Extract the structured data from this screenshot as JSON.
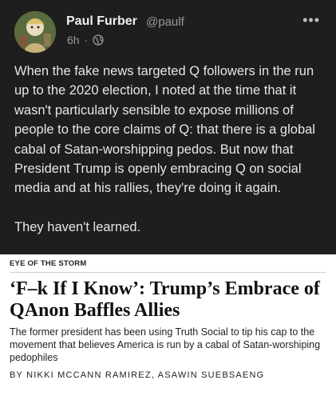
{
  "post": {
    "author_name": "Paul Furber",
    "author_handle": "@paulf",
    "age": "6h",
    "separator": "·",
    "more_label": "•••",
    "paragraphs": [
      "When the fake news targeted Q followers in the run up to the 2020 election, I noted at the time that it wasn't particularly sensible to expose millions of people to the core claims of Q: that there is a global cabal of Satan-worshipping pedos. But now that President Trump is openly embracing Q on social media and at his rallies, they're doing it again.",
      "They haven't learned."
    ]
  },
  "article": {
    "kicker": "EYE OF THE STORM",
    "headline": "‘F–k If I Know’: Trump’s Embrace of QAnon Baffles Allies",
    "dek": "The former president has been using Truth Social to tip his cap to the movement that believes America is run by a cabal of Satan-worshiping pedophiles",
    "byline": "BY NIKKI MCCANN RAMIREZ, ASAWIN SUEBSAENG"
  },
  "icons": {
    "avatar": "avatar-image",
    "visibility": "globe-icon",
    "menu": "more-options-icon"
  },
  "colors": {
    "post_bg": "#1e1e1e",
    "article_bg": "#ffffff",
    "muted_text": "#9a9a9a"
  }
}
